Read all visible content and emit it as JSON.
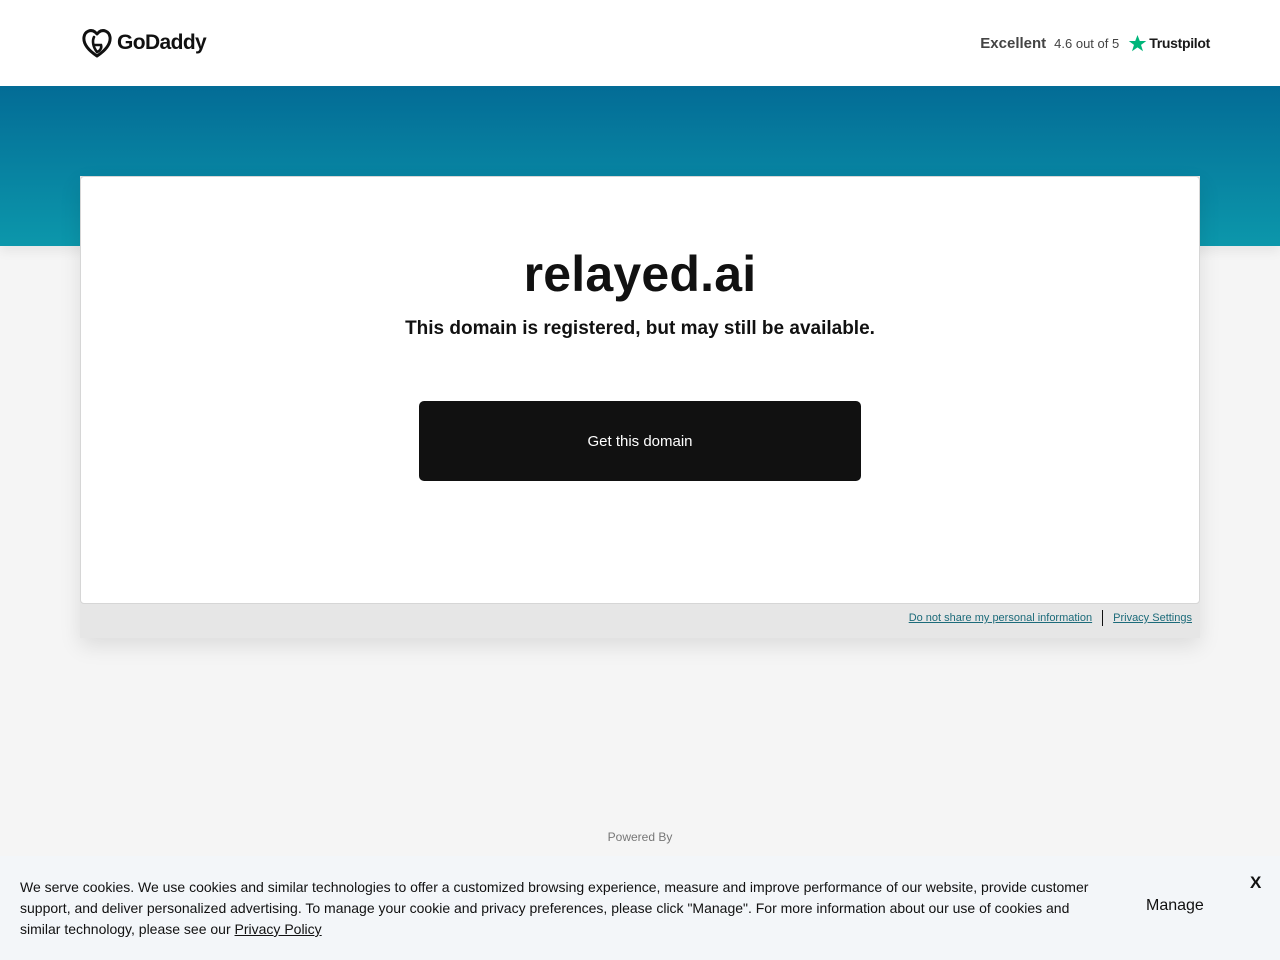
{
  "header": {
    "logo_text": "GoDaddy",
    "trustpilot": {
      "rating_word": "Excellent",
      "score_text": "4.6 out of 5",
      "brand": "Trustpilot",
      "star_color": "#00b67a"
    }
  },
  "hero": {
    "gradient_top": "#036c96",
    "gradient_bottom": "#0c97ab"
  },
  "card": {
    "domain": "relayed.ai",
    "status": "This domain is registered, but may still be available.",
    "cta_label": "Get this domain",
    "legal_links": {
      "do_not_share": "Do not share my personal information",
      "privacy_settings": "Privacy Settings"
    }
  },
  "footer": {
    "powered_by": "Powered By"
  },
  "cookie_banner": {
    "text": "We serve cookies. We use cookies and similar technologies to offer a customized browsing experience, measure and improve performance of our website, provide customer support, and deliver personalized advertising. To manage your cookie and privacy preferences, please click \"Manage\". For more information about our use of cookies and similar technology, please see our ",
    "privacy_link": "Privacy Policy",
    "manage_label": "Manage",
    "close_label": "X"
  }
}
